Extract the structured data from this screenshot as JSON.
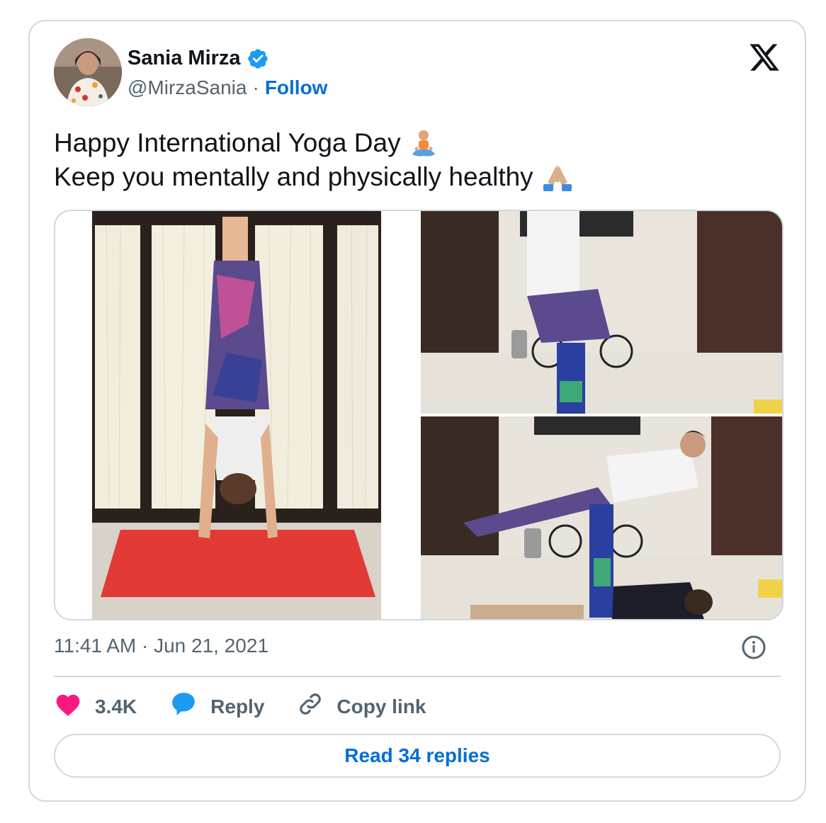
{
  "author": {
    "name": "Sania Mirza",
    "handle": "@MirzaSania",
    "separator": "·",
    "follow_label": "Follow"
  },
  "tweet": {
    "line1": "Happy International Yoga Day",
    "line2": "Keep you mentally and physically healthy",
    "emoji1": "person-in-lotus-position-emoji",
    "emoji2": "folded-hands-emoji"
  },
  "media": {
    "photos": [
      "photo-headstand",
      "photo-partner-pose-1",
      "photo-partner-pose-2"
    ]
  },
  "timestamp": "11:41 AM · Jun 21, 2021",
  "actions": {
    "like_count": "3.4K",
    "reply_label": "Reply",
    "copy_label": "Copy link"
  },
  "read_replies_label": "Read 34 replies",
  "colors": {
    "accent": "#006fd6",
    "verified": "#1d9bf0",
    "like": "#f91880",
    "border": "#cfd9de",
    "secondary_text": "#536471"
  }
}
